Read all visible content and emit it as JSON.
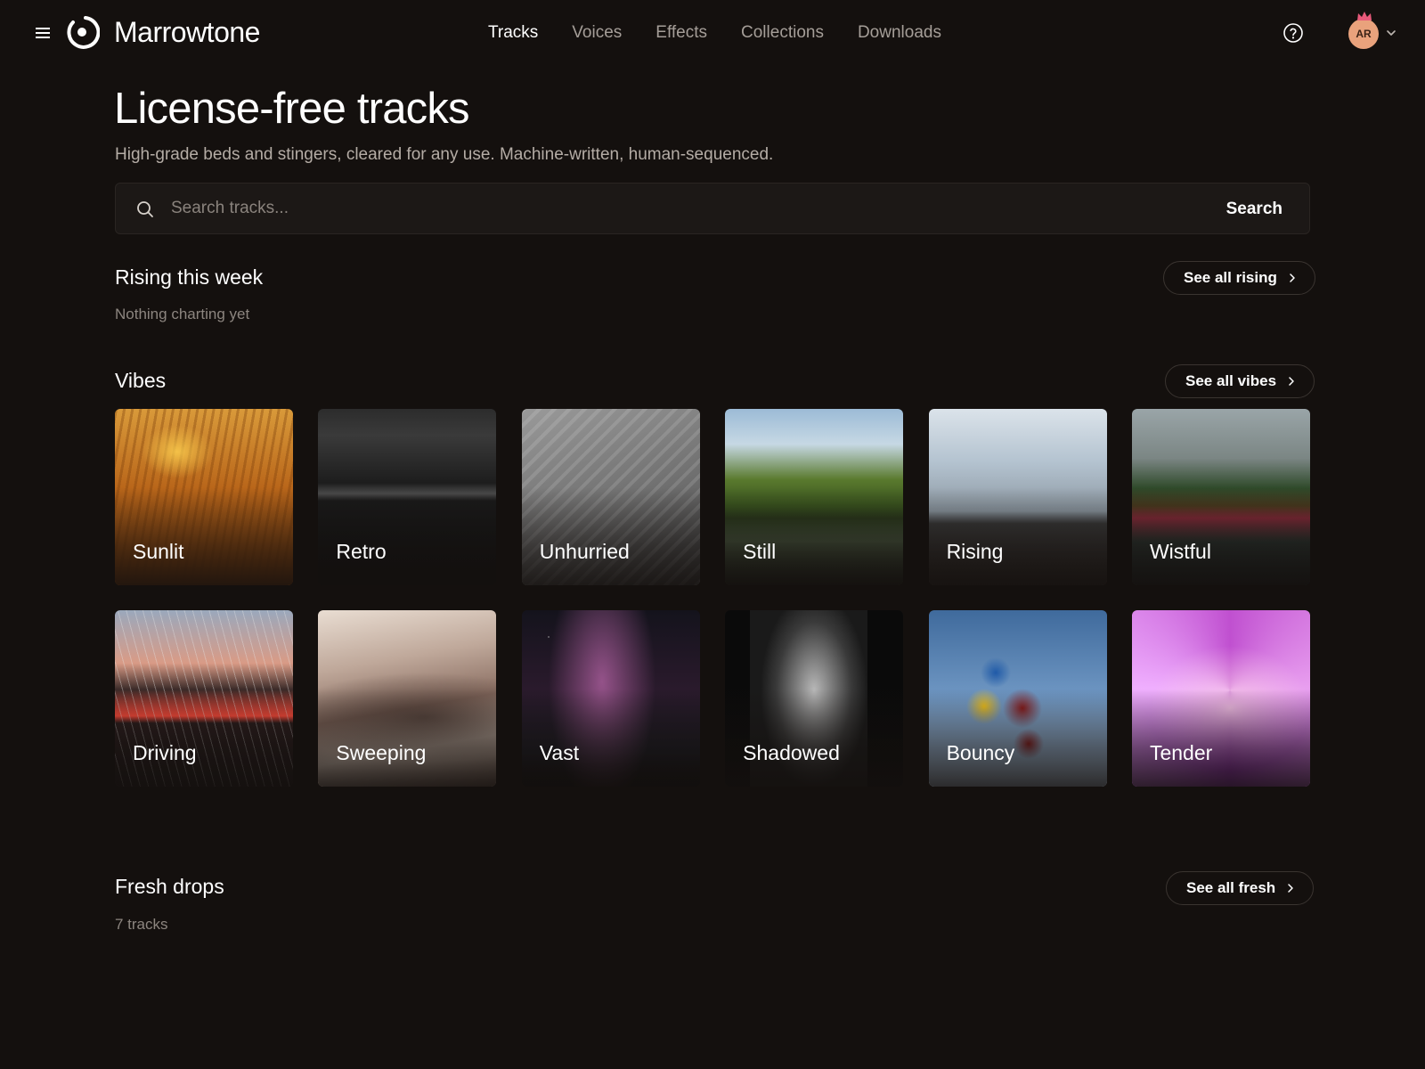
{
  "app": {
    "name": "Marrowtone"
  },
  "nav": [
    {
      "label": "Tracks",
      "active": true
    },
    {
      "label": "Voices",
      "active": false
    },
    {
      "label": "Effects",
      "active": false
    },
    {
      "label": "Collections",
      "active": false
    },
    {
      "label": "Downloads",
      "active": false
    }
  ],
  "user": {
    "initials": "AR",
    "avatar_color": "#e9a27c"
  },
  "hero": {
    "title": "License-free tracks",
    "subtitle": "High-grade beds and stingers, cleared for any use. Machine-written, human-sequenced."
  },
  "search": {
    "placeholder": "Search tracks...",
    "value": "",
    "button_label": "Search"
  },
  "rising": {
    "title": "Rising this week",
    "empty_text": "Nothing charting yet",
    "see_all_label": "See all rising"
  },
  "vibes": {
    "title": "Vibes",
    "see_all_label": "See all vibes",
    "items": [
      {
        "label": "Sunlit"
      },
      {
        "label": "Retro"
      },
      {
        "label": "Unhurried"
      },
      {
        "label": "Still"
      },
      {
        "label": "Rising"
      },
      {
        "label": "Wistful"
      },
      {
        "label": "Driving"
      },
      {
        "label": "Sweeping"
      },
      {
        "label": "Vast"
      },
      {
        "label": "Shadowed"
      },
      {
        "label": "Bouncy"
      },
      {
        "label": "Tender"
      }
    ]
  },
  "fresh": {
    "title": "Fresh drops",
    "count_text": "7 tracks",
    "see_all_label": "See all fresh"
  },
  "colors": {
    "background": "#14100e",
    "muted_text": "#a59e98",
    "border": "#3a3430"
  }
}
